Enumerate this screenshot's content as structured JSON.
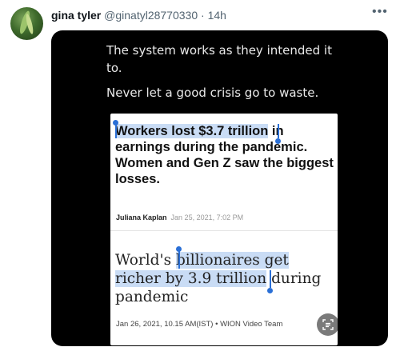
{
  "author": {
    "name": "gina tyler",
    "handle": "@ginatyl28770330",
    "separator": "·",
    "time": "14h"
  },
  "more_icon": "more-horizontal-icon",
  "media": {
    "caption_line1": "The system works as they intended it to.",
    "caption_line2": "Never let a good crisis go to waste.",
    "article1": {
      "headline_selected": "Workers lost $3.7 trillion",
      "headline_rest": " in earnings during the pandemic. Women and Gen Z saw the biggest losses.",
      "author": "Juliana Kaplan",
      "date": "Jan 25, 2021, 7:02 PM"
    },
    "article2": {
      "headline_before": "World's ",
      "headline_selected": "billionaires get richer by 3.9 trillion",
      "headline_after": " during pandemic",
      "meta": "Jan 26, 2021, 10.15 AM(IST) • WION Video Team"
    },
    "lens_icon": "google-lens-icon"
  },
  "colors": {
    "selection": "#c9dcf5",
    "handle": "#2a6fd6",
    "media_background": "#000000"
  }
}
